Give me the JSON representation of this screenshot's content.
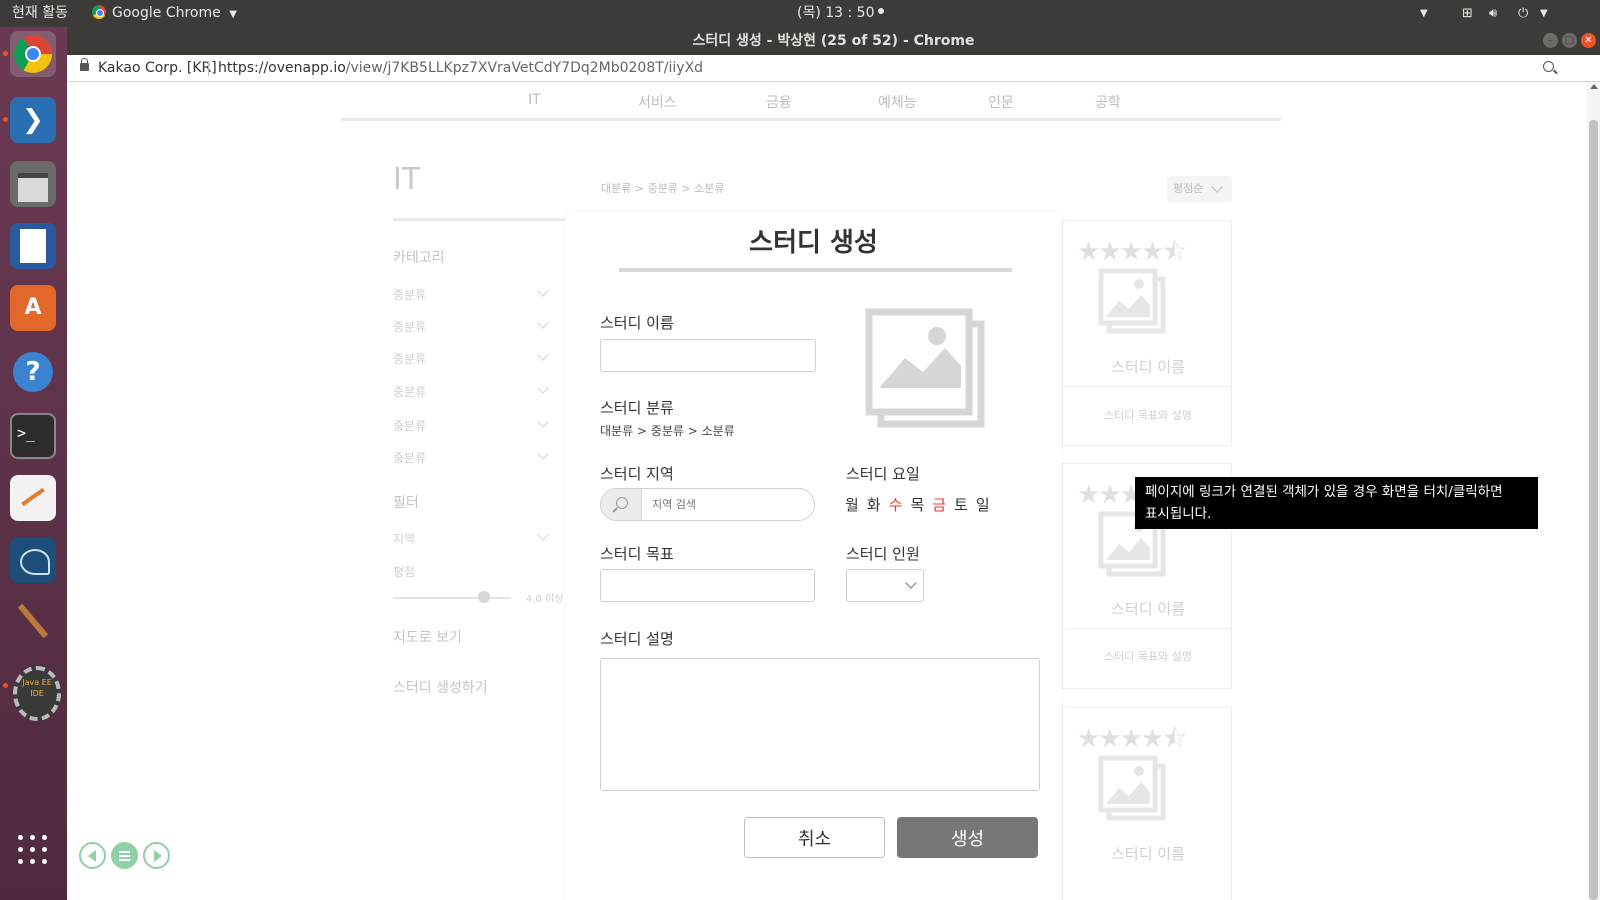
{
  "topbar": {
    "activities": "현재 활동",
    "app_name": "Google Chrome",
    "clock": "(목) 13 : 50"
  },
  "window": {
    "title": "스터디 생성 - 박상현 (25 of 52) - Chrome"
  },
  "addressbar": {
    "site_identity": "Kakao Corp. [KR]",
    "url_host": "https://ovenapp.io",
    "url_path": "/view/j7KB5LLKpz7XVraVetCdY7Dq2Mb0208T/iiyXd"
  },
  "launcher": {
    "items": [
      "chrome-icon",
      "vscode-icon",
      "files-icon",
      "writer-icon",
      "software-center-icon",
      "help-icon",
      "terminal-icon",
      "text-editor-icon",
      "mysql-workbench-icon",
      "paint-icon",
      "java-ee-ide-icon",
      "show-apps-icon"
    ],
    "java_label": "Java EE IDE"
  },
  "background": {
    "categories": [
      "IT",
      "서비스",
      "금융",
      "예체능",
      "인문",
      "공학"
    ],
    "page_title": "IT",
    "breadcrumb": "대분류 > 중분류 > 소분류",
    "sort_label": "평점순",
    "sidebar": {
      "category_heading": "카테고리",
      "subcategories": [
        "중분류",
        "중분류",
        "중분류",
        "중분류",
        "중분류",
        "중분류"
      ],
      "filter_heading": "필터",
      "region_label": "지역",
      "rating_label": "평점",
      "rating_value": "4.0 이상",
      "map_view": "지도로 보기",
      "create_study": "스터디 생성하기"
    },
    "cards": [
      {
        "name": "스터디 이름",
        "desc": "스터디 목표와 설명"
      },
      {
        "name": "스터디 이름",
        "desc": "스터디 목표와 설명"
      },
      {
        "name": "스터디 이름",
        "desc": ""
      }
    ]
  },
  "modal": {
    "title": "스터디 생성",
    "name_label": "스터디 이름",
    "name_value": "",
    "category_label": "스터디 분류",
    "category_crumb": "대분류 > 중분류 > 소분류",
    "region_label": "스터디 지역",
    "region_placeholder": "지역 검색",
    "days_label": "스터디 요일",
    "days": [
      {
        "label": "월",
        "selected": false
      },
      {
        "label": "화",
        "selected": false
      },
      {
        "label": "수",
        "selected": true
      },
      {
        "label": "목",
        "selected": false
      },
      {
        "label": "금",
        "selected": true
      },
      {
        "label": "토",
        "selected": false
      },
      {
        "label": "일",
        "selected": false
      }
    ],
    "goal_label": "스터디 목표",
    "goal_value": "",
    "people_label": "스터디 인원",
    "people_value": "",
    "desc_label": "스터디 설명",
    "desc_value": "",
    "cancel_label": "취소",
    "create_label": "생성"
  },
  "tooltip": {
    "text_line1": "페이지에 링크가 연결된 객체가 있을 경우 화면을 터치/클릭하면",
    "text_line2": "표시됩니다."
  },
  "colors": {
    "panel": "#3c3b37",
    "selected_day": "#e53935",
    "create_button": "#777777",
    "nav_green": "#8fd0a8"
  }
}
